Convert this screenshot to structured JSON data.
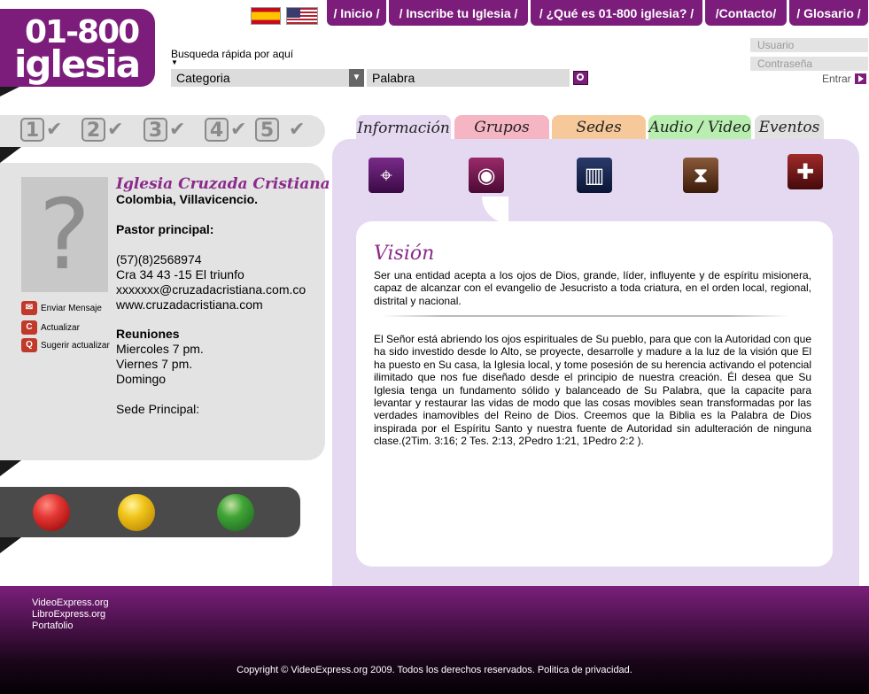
{
  "logo": {
    "line1": "01-800",
    "line2": "iglesia"
  },
  "nav": [
    "/ Inicio /",
    "/ Inscribe tu Iglesia /",
    "/ ¿Qué es 01-800 iglesia? /",
    "/Contacto/",
    "/ Glosario /"
  ],
  "search": {
    "label": "Busqueda rápida por aquí",
    "arrow": "▼",
    "category": "Categoria",
    "keyword": "Palabra",
    "select_arrow": "▼"
  },
  "login": {
    "user_placeholder": "Usuario",
    "password_placeholder": "Contraseña",
    "submit": "Entrar"
  },
  "steps": [
    "1",
    "2",
    "3",
    "4",
    "5"
  ],
  "step_check": "✔",
  "profile": {
    "photo_glyph": "?",
    "name": "Iglesia Cruzada Cristiana",
    "location": "Colombia, Villavicencio.",
    "pastor_heading": "Pastor principal:",
    "phone": "(57)(8)2568974",
    "address": "Cra 34 43 -15 El triunfo",
    "email": "xxxxxxx@cruzadacristiana.com.co",
    "website": "www.cruzadacristiana.com",
    "meetings_heading": "Reuniones",
    "meetings": [
      "Miercoles 7 pm.",
      "Viernes 7 pm.",
      "Domingo"
    ],
    "main_site": "Sede Principal:"
  },
  "actions": [
    {
      "label": "Enviar Mensaje",
      "icon": "✉"
    },
    {
      "label": "Actualizar",
      "icon": "C"
    },
    {
      "label": "Sugerir actualizar",
      "icon": "Q"
    }
  ],
  "colors": {
    "brand": "#7c1d7c",
    "light_red": "#c0392b",
    "light_yellow": "#f0c419",
    "light_green": "#3fa535"
  },
  "tabs": [
    "Información",
    "Grupos",
    "Sedes",
    "Audio / Video",
    "Eventos"
  ],
  "section_icons": [
    "target-icon",
    "eye-icon",
    "book-icon",
    "hourglass-icon",
    "cross-speech-icon"
  ],
  "section_icon_glyphs": [
    "⌖",
    "◉",
    "▥",
    "⧗",
    "✚"
  ],
  "content": {
    "title": "Visión",
    "paragraph1": "Ser una entidad acepta a los ojos de Dios, grande, líder, influyente y de espíritu misionera, capaz de alcanzar con el evangelio de Jesucristo a toda criatura, en el orden local, regional, distrital y nacional.",
    "paragraph2": "El Señor está abriendo los ojos espirituales de Su pueblo, para que con la Autoridad con que ha sido investido desde lo Alto, se proyecte, desarrolle y madure a la luz de la visión que El ha puesto en Su casa, la Iglesia local, y tome posesión de su herencia activando el potencial ilimitado que nos fue diseñado desde el principio de nuestra creación. Él desea que Su Iglesia tenga un fundamento sólido y balanceado de Su Palabra, que la capacite para levantar y restaurar las vidas de modo que las cosas movibles sean transformadas por las verdades inamovibles del Reino de Dios. Creemos que la Biblia es la Palabra de Dios inspirada por el Espíritu Santo y nuestra fuente de Autoridad sin adulteración de ninguna clase.(2Tim. 3:16; 2 Tes. 2:13, 2Pedro 1:21, 1Pedro 2:2 )."
  },
  "footer": {
    "links": [
      "VideoExpress.org",
      "LibroExpress.org",
      "Portafolio"
    ],
    "copyright": "Copyright © VideoExpress.org 2009. Todos los derechos reservados. Politica de privacidad."
  }
}
